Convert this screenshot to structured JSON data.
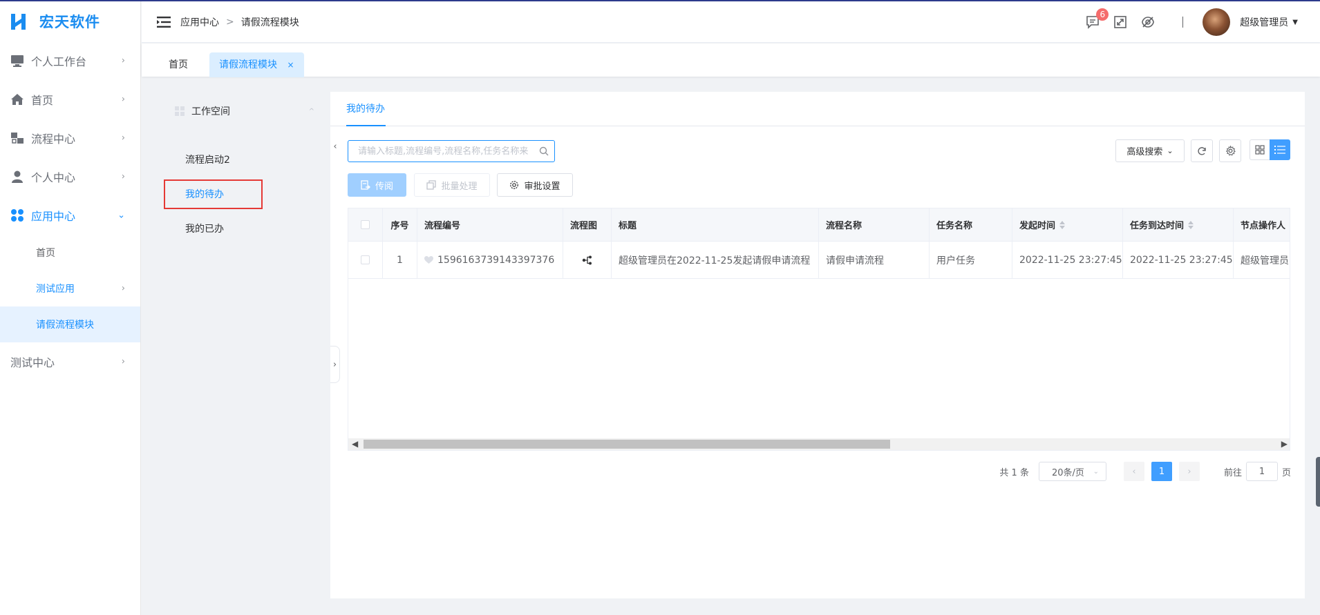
{
  "brand": {
    "name": "宏天软件",
    "color": "#1a8cf0"
  },
  "sidebar": {
    "items": [
      {
        "label": "个人工作台",
        "icon": "monitor-icon"
      },
      {
        "label": "首页",
        "icon": "home-icon"
      },
      {
        "label": "流程中心",
        "icon": "flow-icon"
      },
      {
        "label": "个人中心",
        "icon": "user-icon"
      },
      {
        "label": "应用中心",
        "icon": "apps-icon",
        "expanded": true
      },
      {
        "label": "测试中心",
        "icon": ""
      }
    ],
    "subitems": [
      {
        "label": "首页"
      },
      {
        "label": "测试应用"
      },
      {
        "label": "请假流程模块",
        "selected": true
      }
    ]
  },
  "header": {
    "breadcrumb": [
      "应用中心",
      "请假流程模块"
    ],
    "badge_count": "6",
    "username": "超级管理员"
  },
  "tabs": [
    {
      "label": "首页"
    },
    {
      "label": "请假流程模块",
      "active": true,
      "close": "×"
    }
  ],
  "workspace": {
    "title": "工作空间",
    "items": [
      "流程启动2",
      "我的待办",
      "我的已办"
    ]
  },
  "main": {
    "tab": "我的待办",
    "search_placeholder": "请输入标题,流程编号,流程名称,任务名称来搜索",
    "advanced_search": "高级搜索",
    "buttons": {
      "forward": "传阅",
      "batch": "批量处理",
      "approve_settings": "审批设置"
    },
    "table": {
      "columns": [
        "序号",
        "流程编号",
        "流程图",
        "标题",
        "流程名称",
        "任务名称",
        "发起时间",
        "任务到达时间",
        "节点操作人"
      ],
      "rows": [
        {
          "index": "1",
          "number": "1596163739143397376",
          "title": "超级管理员在2022-11-25发起请假申请流程",
          "process_name": "请假申请流程",
          "task_name": "用户任务",
          "start_time": "2022-11-25 23:27:45",
          "arrival_time": "2022-11-25 23:27:45",
          "operator": "超级管理员"
        }
      ]
    },
    "pagination": {
      "total": "共 1 条",
      "page_size": "20条/页",
      "current_page": "1",
      "goto_label": "前往",
      "goto_value": "1",
      "page_suffix": "页"
    }
  },
  "colors": {
    "accent": "#1890ff",
    "highlight_box": "#e53935",
    "badge": "#f56c6c"
  }
}
